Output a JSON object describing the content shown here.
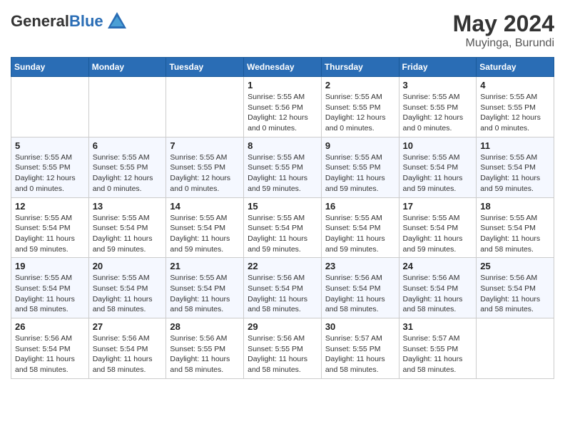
{
  "header": {
    "logo_general": "General",
    "logo_blue": "Blue",
    "month": "May 2024",
    "location": "Muyinga, Burundi"
  },
  "weekdays": [
    "Sunday",
    "Monday",
    "Tuesday",
    "Wednesday",
    "Thursday",
    "Friday",
    "Saturday"
  ],
  "weeks": [
    [
      {
        "day": "",
        "info": ""
      },
      {
        "day": "",
        "info": ""
      },
      {
        "day": "",
        "info": ""
      },
      {
        "day": "1",
        "info": "Sunrise: 5:55 AM\nSunset: 5:56 PM\nDaylight: 12 hours\nand 0 minutes."
      },
      {
        "day": "2",
        "info": "Sunrise: 5:55 AM\nSunset: 5:55 PM\nDaylight: 12 hours\nand 0 minutes."
      },
      {
        "day": "3",
        "info": "Sunrise: 5:55 AM\nSunset: 5:55 PM\nDaylight: 12 hours\nand 0 minutes."
      },
      {
        "day": "4",
        "info": "Sunrise: 5:55 AM\nSunset: 5:55 PM\nDaylight: 12 hours\nand 0 minutes."
      }
    ],
    [
      {
        "day": "5",
        "info": "Sunrise: 5:55 AM\nSunset: 5:55 PM\nDaylight: 12 hours\nand 0 minutes."
      },
      {
        "day": "6",
        "info": "Sunrise: 5:55 AM\nSunset: 5:55 PM\nDaylight: 12 hours\nand 0 minutes."
      },
      {
        "day": "7",
        "info": "Sunrise: 5:55 AM\nSunset: 5:55 PM\nDaylight: 12 hours\nand 0 minutes."
      },
      {
        "day": "8",
        "info": "Sunrise: 5:55 AM\nSunset: 5:55 PM\nDaylight: 11 hours\nand 59 minutes."
      },
      {
        "day": "9",
        "info": "Sunrise: 5:55 AM\nSunset: 5:55 PM\nDaylight: 11 hours\nand 59 minutes."
      },
      {
        "day": "10",
        "info": "Sunrise: 5:55 AM\nSunset: 5:54 PM\nDaylight: 11 hours\nand 59 minutes."
      },
      {
        "day": "11",
        "info": "Sunrise: 5:55 AM\nSunset: 5:54 PM\nDaylight: 11 hours\nand 59 minutes."
      }
    ],
    [
      {
        "day": "12",
        "info": "Sunrise: 5:55 AM\nSunset: 5:54 PM\nDaylight: 11 hours\nand 59 minutes."
      },
      {
        "day": "13",
        "info": "Sunrise: 5:55 AM\nSunset: 5:54 PM\nDaylight: 11 hours\nand 59 minutes."
      },
      {
        "day": "14",
        "info": "Sunrise: 5:55 AM\nSunset: 5:54 PM\nDaylight: 11 hours\nand 59 minutes."
      },
      {
        "day": "15",
        "info": "Sunrise: 5:55 AM\nSunset: 5:54 PM\nDaylight: 11 hours\nand 59 minutes."
      },
      {
        "day": "16",
        "info": "Sunrise: 5:55 AM\nSunset: 5:54 PM\nDaylight: 11 hours\nand 59 minutes."
      },
      {
        "day": "17",
        "info": "Sunrise: 5:55 AM\nSunset: 5:54 PM\nDaylight: 11 hours\nand 59 minutes."
      },
      {
        "day": "18",
        "info": "Sunrise: 5:55 AM\nSunset: 5:54 PM\nDaylight: 11 hours\nand 58 minutes."
      }
    ],
    [
      {
        "day": "19",
        "info": "Sunrise: 5:55 AM\nSunset: 5:54 PM\nDaylight: 11 hours\nand 58 minutes."
      },
      {
        "day": "20",
        "info": "Sunrise: 5:55 AM\nSunset: 5:54 PM\nDaylight: 11 hours\nand 58 minutes."
      },
      {
        "day": "21",
        "info": "Sunrise: 5:55 AM\nSunset: 5:54 PM\nDaylight: 11 hours\nand 58 minutes."
      },
      {
        "day": "22",
        "info": "Sunrise: 5:56 AM\nSunset: 5:54 PM\nDaylight: 11 hours\nand 58 minutes."
      },
      {
        "day": "23",
        "info": "Sunrise: 5:56 AM\nSunset: 5:54 PM\nDaylight: 11 hours\nand 58 minutes."
      },
      {
        "day": "24",
        "info": "Sunrise: 5:56 AM\nSunset: 5:54 PM\nDaylight: 11 hours\nand 58 minutes."
      },
      {
        "day": "25",
        "info": "Sunrise: 5:56 AM\nSunset: 5:54 PM\nDaylight: 11 hours\nand 58 minutes."
      }
    ],
    [
      {
        "day": "26",
        "info": "Sunrise: 5:56 AM\nSunset: 5:54 PM\nDaylight: 11 hours\nand 58 minutes."
      },
      {
        "day": "27",
        "info": "Sunrise: 5:56 AM\nSunset: 5:54 PM\nDaylight: 11 hours\nand 58 minutes."
      },
      {
        "day": "28",
        "info": "Sunrise: 5:56 AM\nSunset: 5:55 PM\nDaylight: 11 hours\nand 58 minutes."
      },
      {
        "day": "29",
        "info": "Sunrise: 5:56 AM\nSunset: 5:55 PM\nDaylight: 11 hours\nand 58 minutes."
      },
      {
        "day": "30",
        "info": "Sunrise: 5:57 AM\nSunset: 5:55 PM\nDaylight: 11 hours\nand 58 minutes."
      },
      {
        "day": "31",
        "info": "Sunrise: 5:57 AM\nSunset: 5:55 PM\nDaylight: 11 hours\nand 58 minutes."
      },
      {
        "day": "",
        "info": ""
      }
    ]
  ]
}
